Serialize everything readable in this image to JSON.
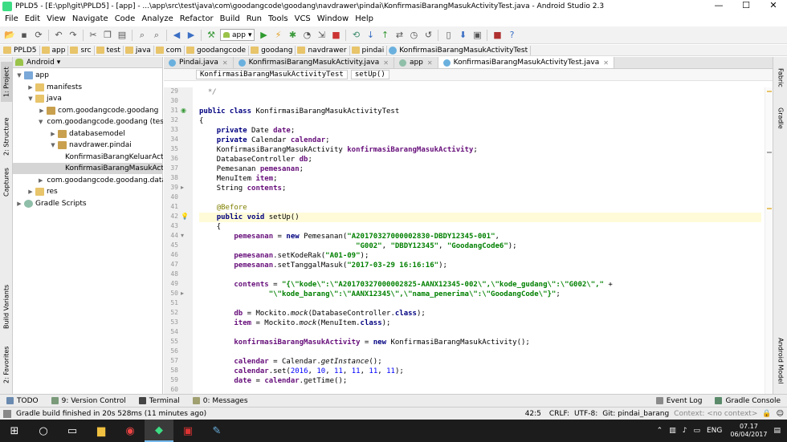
{
  "window": {
    "title": "PPLD5 - [E:\\ppl\\git\\PPLD5] - [app] - ...\\app\\src\\test\\java\\com\\goodangcode\\goodang\\navdrawer\\pindai\\KonfirmasiBarangMasukActivityTest.java - Android Studio 2.3",
    "minimize": "—",
    "maximize": "☐",
    "close": "✕"
  },
  "menu": [
    "File",
    "Edit",
    "View",
    "Navigate",
    "Code",
    "Analyze",
    "Refactor",
    "Build",
    "Run",
    "Tools",
    "VCS",
    "Window",
    "Help"
  ],
  "toolbar": {
    "run_config": "app"
  },
  "navbar": [
    "PPLD5",
    "app",
    "src",
    "test",
    "java",
    "com",
    "goodangcode",
    "goodang",
    "navdrawer",
    "pindai",
    "KonfirmasiBarangMasukActivityTest"
  ],
  "project": {
    "view": "Android",
    "tree": [
      {
        "label": "app",
        "type": "mod",
        "indent": 0,
        "arrow": "▼"
      },
      {
        "label": "manifests",
        "type": "folder",
        "indent": 1,
        "arrow": "▶"
      },
      {
        "label": "java",
        "type": "folder",
        "indent": 1,
        "arrow": "▼"
      },
      {
        "label": "com.goodangcode.goodang",
        "type": "pkg",
        "indent": 2,
        "arrow": "▶"
      },
      {
        "label": "com.goodangcode.goodang (test)",
        "type": "pkg",
        "indent": 2,
        "arrow": "▼"
      },
      {
        "label": "databasemodel",
        "type": "pkg",
        "indent": 3,
        "arrow": "▶"
      },
      {
        "label": "navdrawer.pindai",
        "type": "pkg",
        "indent": 3,
        "arrow": "▼"
      },
      {
        "label": "KonfirmasiBarangKeluarActivityTest",
        "type": "cls",
        "indent": 4,
        "arrow": ""
      },
      {
        "label": "KonfirmasiBarangMasukActivityTest",
        "type": "cls",
        "indent": 4,
        "arrow": "",
        "selected": true
      },
      {
        "label": "com.goodangcode.goodang.database (androidTest)",
        "type": "pkg",
        "indent": 2,
        "arrow": "▶"
      },
      {
        "label": "res",
        "type": "folder",
        "indent": 1,
        "arrow": "▶"
      },
      {
        "label": "Gradle Scripts",
        "type": "gradle",
        "indent": 0,
        "arrow": "▶"
      }
    ]
  },
  "left_tools": [
    "1: Project",
    "2: Structure",
    "Captures",
    "Build Variants",
    "2: Favorites"
  ],
  "right_tools": [
    "Fabric",
    "Gradle",
    "Android Model"
  ],
  "editor": {
    "tabs": [
      {
        "label": "Pindai.java",
        "active": false
      },
      {
        "label": "KonfirmasiBarangMasukActivity.java",
        "active": false
      },
      {
        "label": "app",
        "active": false
      },
      {
        "label": "KonfirmasiBarangMasukActivityTest.java",
        "active": true
      }
    ],
    "breadcrumbs": [
      "KonfirmasiBarangMasukActivityTest",
      "setUp()"
    ],
    "line_numbers": [
      "29",
      "30",
      "31",
      "32",
      "33",
      "34",
      "35",
      "36",
      "37",
      "38",
      "39",
      "40",
      "41",
      "42",
      "43",
      "44",
      "45",
      "46",
      "47",
      "48",
      "49",
      "50",
      "51",
      "52",
      "53",
      "54",
      "55",
      "56",
      "57",
      "58",
      "59",
      "60"
    ],
    "current_line_index": 13
  },
  "bottom_tools": {
    "todo": "TODO",
    "version_control": "9: Version Control",
    "terminal": "Terminal",
    "messages": "0: Messages",
    "event_log": "Event Log",
    "gradle_console": "Gradle Console"
  },
  "status": {
    "message": "Gradle build finished in 20s 528ms (11 minutes ago)",
    "position": "42:5",
    "line_sep": "CRLF:",
    "encoding": "UTF-8:",
    "git": "Git: pindai_barang",
    "context": "Context: <no context>"
  },
  "taskbar": {
    "lang": "ENG",
    "time": "07.17",
    "date": "06/04/2017"
  }
}
